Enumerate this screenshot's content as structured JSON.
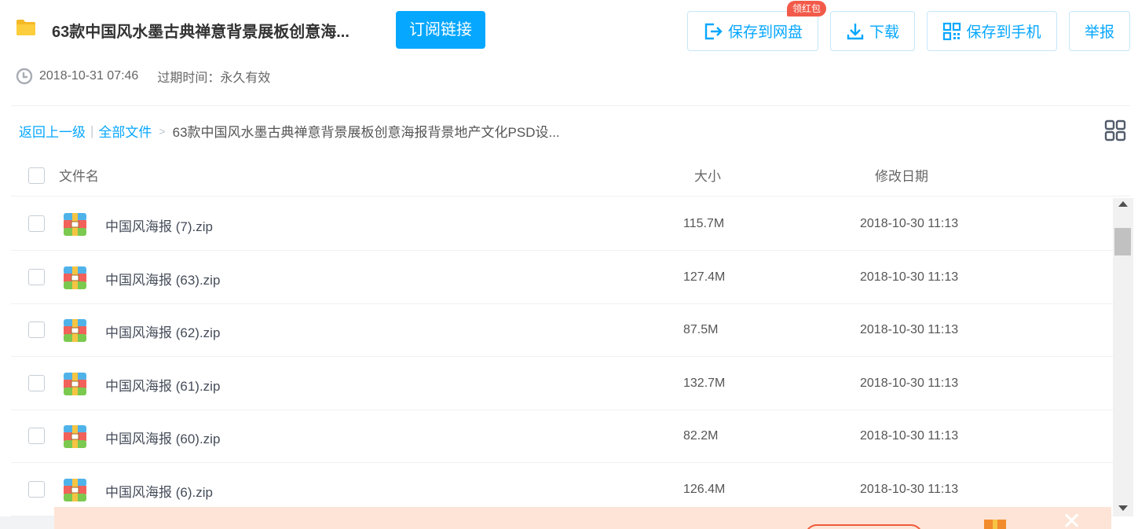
{
  "header": {
    "title": "63款中国风水墨古典禅意背景展板创意海...",
    "subscribe_label": "订阅链接",
    "save_to_disk_label": "保存到网盘",
    "badge_label": "领红包",
    "download_label": "下载",
    "save_to_phone_label": "保存到手机",
    "report_label": "举报",
    "icons": {
      "folder": "folder-icon",
      "save": "save-export-icon",
      "download": "download-icon",
      "phone": "qr-code-icon",
      "clock": "clock-icon"
    }
  },
  "meta": {
    "date": "2018-10-31 07:46",
    "expiry": "过期时间：永久有效"
  },
  "breadcrumb": {
    "back": "返回上一级",
    "separator": "|",
    "all_files": "全部文件",
    "arrow": ">",
    "current": "63款中国风水墨古典禅意背景展板创意海报背景地产文化PSD设..."
  },
  "table": {
    "columns": {
      "name": "文件名",
      "size": "大小",
      "date": "修改日期"
    },
    "rows": [
      {
        "name": "中国风海报 (7).zip",
        "size": "115.7M",
        "date": "2018-10-30 11:13"
      },
      {
        "name": "中国风海报 (63).zip",
        "size": "127.4M",
        "date": "2018-10-30 11:13"
      },
      {
        "name": "中国风海报 (62).zip",
        "size": "87.5M",
        "date": "2018-10-30 11:13"
      },
      {
        "name": "中国风海报 (61).zip",
        "size": "132.7M",
        "date": "2018-10-30 11:13"
      },
      {
        "name": "中国风海报 (60).zip",
        "size": "82.2M",
        "date": "2018-10-30 11:13"
      },
      {
        "name": "中国风海报 (6).zip",
        "size": "126.4M",
        "date": "2018-10-30 11:13"
      }
    ]
  },
  "colors": {
    "accent": "#06a7ff",
    "badge": "#f25a4a",
    "banner_bg": "#fde4d6",
    "banner_text": "#f03a1d"
  }
}
